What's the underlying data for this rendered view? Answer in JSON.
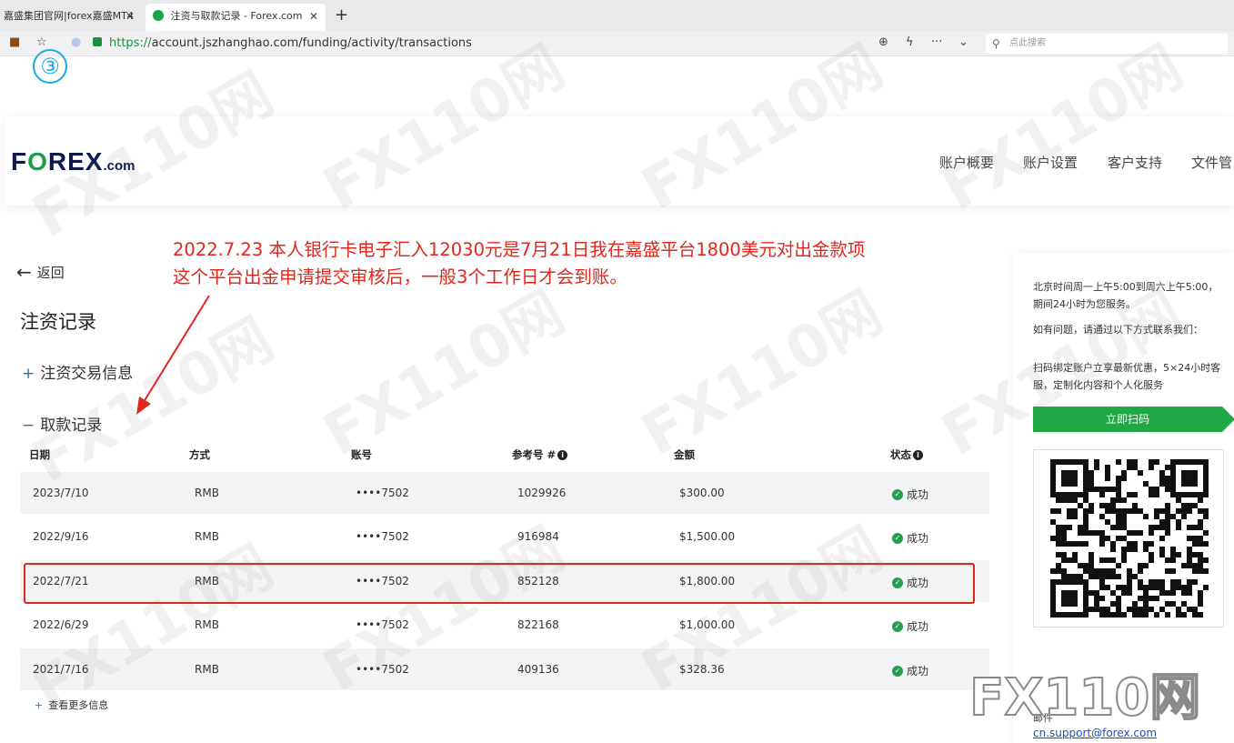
{
  "browser": {
    "tabs": [
      {
        "title": "嘉盛集团官网|forex嘉盛MT4"
      },
      {
        "title": "注资与取款记录 - Forex.com"
      }
    ],
    "tab_close_glyph": "✕",
    "new_tab_glyph": "+",
    "url_protocol": "https://",
    "url_rest": "account.jszhanghao.com/funding/activity/transactions",
    "search_placeholder": "点此搜索",
    "annotation_number": "③"
  },
  "header": {
    "logo_f": "F",
    "logo_o": "O",
    "logo_rex": "REX",
    "logo_com": ".com",
    "nav": [
      "账户概要",
      "账户设置",
      "客户支持",
      "文件管"
    ]
  },
  "page": {
    "back_label": "返回",
    "title": "注资记录",
    "deposit_section": "注资交易信息",
    "withdraw_section": "取款记录",
    "sign_plus": "+",
    "sign_minus": "−",
    "annotation_line1": "2022.7.23  本人银行卡电子汇入12030元是7月21日我在嘉盛平台1800美元对出金款项",
    "annotation_line2": "这个平台出金申请提交审核后，一般3个工作日才会到账。",
    "more_label": "查看更多信息"
  },
  "table": {
    "headers": [
      "日期",
      "方式",
      "账号",
      "参考号 #",
      "金额",
      "状态"
    ],
    "rows": [
      {
        "date": "2023/7/10",
        "method": "RMB",
        "account": "••••7502",
        "ref": "1029926",
        "amount": "$300.00",
        "status": "成功"
      },
      {
        "date": "2022/9/16",
        "method": "RMB",
        "account": "••••7502",
        "ref": "916984",
        "amount": "$1,500.00",
        "status": "成功"
      },
      {
        "date": "2022/7/21",
        "method": "RMB",
        "account": "••••7502",
        "ref": "852128",
        "amount": "$1,800.00",
        "status": "成功"
      },
      {
        "date": "2022/6/29",
        "method": "RMB",
        "account": "••••7502",
        "ref": "822168",
        "amount": "$1,000.00",
        "status": "成功"
      },
      {
        "date": "2021/7/16",
        "method": "RMB",
        "account": "••••7502",
        "ref": "409136",
        "amount": "$328.36",
        "status": "成功"
      }
    ]
  },
  "sidebar": {
    "hours": "北京时间周一上午5:00到周六上午5:00，期间24小时为您服务。",
    "contact": "如有问题，请通过以下方式联系我们：",
    "promo": "扫码绑定账户立享最新优惠，5×24小时客服，定制化内容和个人化服务",
    "scan_button": "立即扫码",
    "email_label": "邮件",
    "support_email": "cn.support@forex.com"
  },
  "colors": {
    "brand_navy": "#0d1a4d",
    "brand_green": "#1f9c49",
    "annotation_red": "#e1261c",
    "success_green": "#2a9c52"
  },
  "watermark_text": "FX110网"
}
